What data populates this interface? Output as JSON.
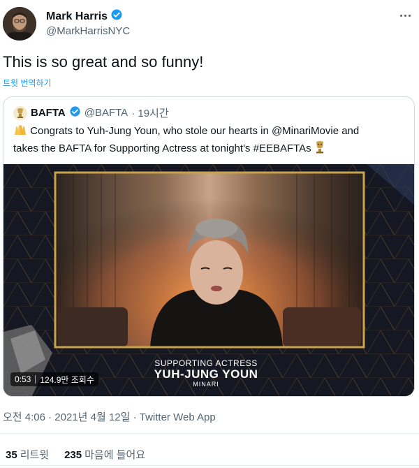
{
  "author": {
    "display_name": "Mark Harris",
    "handle": "@MarkHarrisNYC",
    "verified": true
  },
  "icons": {
    "verified": "verified-badge-icon",
    "more": "more-options-icon"
  },
  "tweet": {
    "text": "This is so great and so funny!",
    "translate_label": "트윗 번역하기"
  },
  "quoted_tweet": {
    "display_name": "BAFTA",
    "handle": "@BAFTA",
    "time": "· 19시간",
    "text_line1": " Congrats to Yuh-Jung Youn, who stole our hearts in @MinariMovie and",
    "text_line2": "takes the BAFTA for Supporting Actress at tonight's #EEBAFTAs ",
    "video": {
      "caption_line1": "SUPPORTING ACTRESS",
      "caption_line2": "YUH-JUNG YOUN",
      "caption_line3": "MINARI",
      "duration": "0:53",
      "views": "124.9만 조회수"
    }
  },
  "meta": {
    "timestamp": "오전 4:06 · 2021년 4월 12일 · Twitter Web App"
  },
  "stats": {
    "retweets_count": "35",
    "retweets_label": "리트윗",
    "likes_count": "235",
    "likes_label": "마음에 들어요"
  },
  "colors": {
    "accent": "#1d9bf0",
    "text_primary": "#0f1419",
    "text_secondary": "#536471",
    "gold_frame": "#c9a24a"
  }
}
